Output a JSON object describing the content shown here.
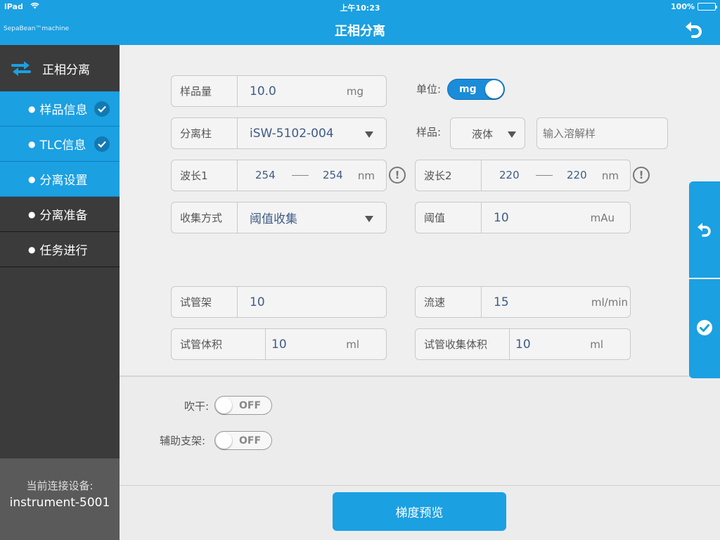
{
  "status_bar": {
    "device": "iPad",
    "time": "上午10:23",
    "battery": "100%"
  },
  "header": {
    "brand": "SepaBean™machine",
    "title": "正相分离"
  },
  "sidebar": {
    "title": "正相分离",
    "items": [
      {
        "label": "样品信息",
        "active": true,
        "done": true
      },
      {
        "label": "TLC信息",
        "active": true,
        "done": true
      },
      {
        "label": "分离设置",
        "active": true,
        "done": false
      },
      {
        "label": "分离准备",
        "active": false,
        "done": false
      },
      {
        "label": "任务进行",
        "active": false,
        "done": false
      }
    ],
    "device_label": "当前连接设备:",
    "device_name": "instrument-5001"
  },
  "form": {
    "sample_amount": {
      "label": "样品量",
      "value": "10.0",
      "unit": "mg"
    },
    "unit_toggle": {
      "label": "单位:",
      "value": "mg"
    },
    "column": {
      "label": "分离柱",
      "value": "iSW-5102-004"
    },
    "sample_type": {
      "label": "样品:",
      "value": "液体"
    },
    "solvent": {
      "placeholder": "输入溶解样"
    },
    "wavelength1": {
      "label": "波长1",
      "from": "254",
      "to": "254",
      "unit": "nm"
    },
    "wavelength2": {
      "label": "波长2",
      "from": "220",
      "to": "220",
      "unit": "nm"
    },
    "collect_mode": {
      "label": "收集方式",
      "value": "阈值收集"
    },
    "threshold": {
      "label": "阈值",
      "value": "10",
      "unit": "mAu"
    },
    "rack": {
      "label": "试管架",
      "value": "10"
    },
    "flow_rate": {
      "label": "流速",
      "value": "15",
      "unit": "ml/min"
    },
    "tube_volume": {
      "label": "试管体积",
      "value": "10",
      "unit": "ml"
    },
    "collect_volume": {
      "label": "试管收集体积",
      "value": "10",
      "unit": "ml"
    },
    "dry": {
      "label": "吹干:",
      "state": "OFF"
    },
    "aux_rack": {
      "label": "辅助支架:",
      "state": "OFF"
    },
    "info_mark": "!"
  },
  "buttons": {
    "gradient_preview": "梯度预览"
  }
}
